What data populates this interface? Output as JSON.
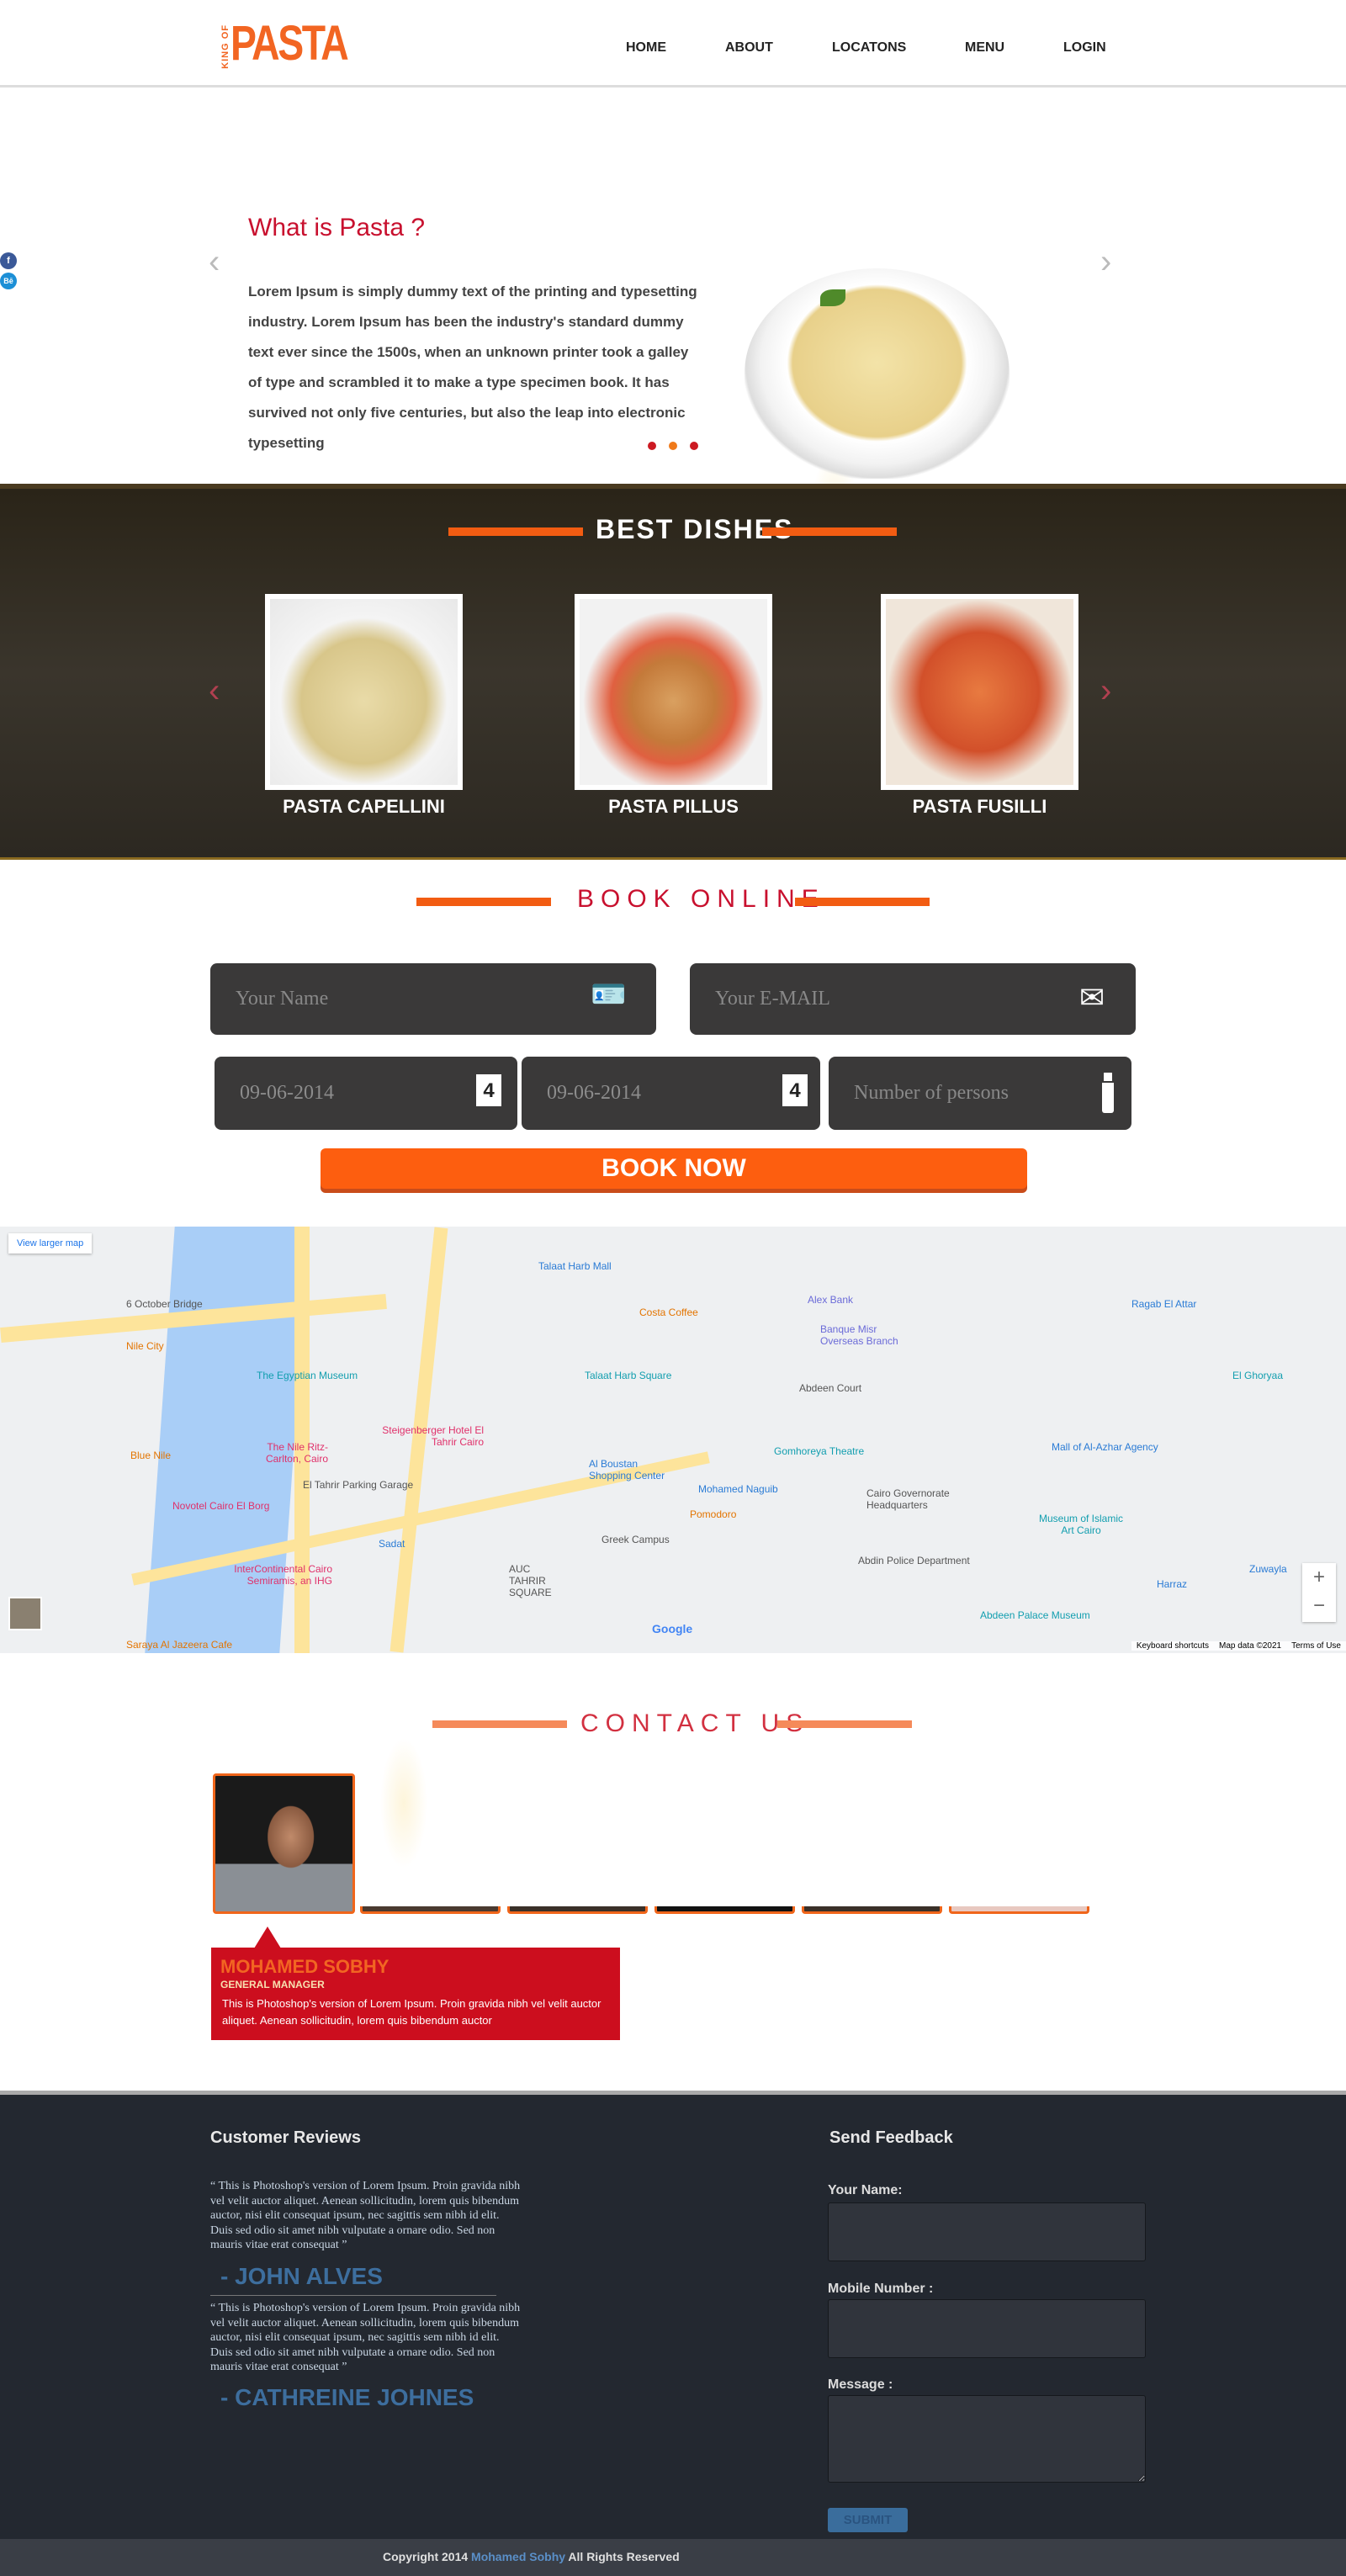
{
  "logo": {
    "small": "KING OF",
    "big": "PASTA"
  },
  "nav": [
    "HOME",
    "ABOUT",
    "LOCATONS",
    "MENU",
    "LOGIN"
  ],
  "hero": {
    "title": "What is Pasta ?",
    "text": "Lorem Ipsum is simply dummy text of the printing and typesetting industry. Lorem Ipsum has been the industry's standard dummy text ever since the 1500s, when an unknown printer took a galley of type and scrambled it to make a type specimen book. It has survived not only five centuries, but also the leap into electronic typesetting",
    "slide_count": 3
  },
  "social": {
    "facebook": "f",
    "behance": "Bē"
  },
  "dishes": {
    "title": "BEST DISHES",
    "items": [
      "PASTA CAPELLINI",
      "PASTA PILLUS",
      "PASTA FUSILLI"
    ]
  },
  "booking": {
    "title": "BOOK ONLINE",
    "name_placeholder": "Your Name",
    "email_placeholder": "Your E-MAIL",
    "date1": "09-06-2014",
    "date2": "09-06-2014",
    "persons_placeholder": "Number of persons",
    "calendar_day": "4",
    "button": "BOOK NOW"
  },
  "map": {
    "larger": "View larger map",
    "labels": [
      "Talaat Harb Mall",
      "Costa Coffee",
      "Alex Bank",
      "Banque Misr Overseas Branch",
      "The Egyptian Museum",
      "Talaat Harb Square",
      "Abdeen Court",
      "Steigenberger Hotel El Tahrir Cairo",
      "The Nile Ritz-Carlton, Cairo",
      "Al Boustan Shopping Center",
      "Gomhoreya Theatre",
      "Mall of Al-Azhar Agency",
      "Mohamed Naguib",
      "Cairo Governorate Headquarters",
      "Novotel Cairo El Borg",
      "Museum of Islamic Art Cairo",
      "Greek Campus",
      "Abdin Police Department",
      "InterContinental Cairo Semiramis, an IHG",
      "Abdeen Palace Museum",
      "Saraya Al Jazeera Cafe",
      "6 October Bridge",
      "Nile City",
      "Blue Nile",
      "El Tahrir Parking Garage",
      "Sadat",
      "Pomodoro",
      "AUC TAHRIR SQUARE",
      "Ragab El Attar",
      "El Ghoryaa",
      "Harraz",
      "Zuwayla"
    ],
    "footer": [
      "Keyboard shortcuts",
      "Map data ©2021",
      "Terms of Use"
    ],
    "google": "Google"
  },
  "contact": {
    "title": "CONTACT US",
    "person": {
      "name": "MOHAMED SOBHY",
      "role": "GENERAL MANAGER",
      "text": "This is Photoshop's version  of Lorem Ipsum. Proin gravida nibh vel velit auctor aliquet. Aenean sollicitudin, lorem quis bibendum auctor"
    }
  },
  "footer": {
    "reviews_title": "Customer Reviews",
    "reviews": [
      {
        "text": "“ This is Photoshop's version of Lorem Ipsum. Proin gravida nibh vel velit auctor aliquet. Aenean sollicitudin, lorem quis bibendum auctor, nisi elit consequat ipsum, nec sagittis sem nibh id elit. Duis sed odio sit amet nibh vulputate a ornare odio. Sed non mauris vitae erat consequat ”",
        "name": "- JOHN ALVES"
      },
      {
        "text": "“ This is Photoshop's version of Lorem Ipsum. Proin gravida nibh vel velit auctor aliquet. Aenean sollicitudin, lorem quis bibendum auctor, nisi elit consequat ipsum, nec sagittis sem nibh id elit. Duis sed odio sit amet nibh vulputate a ornare odio. Sed non mauris vitae erat consequat ”",
        "name": "- CATHREINE JOHNES"
      }
    ],
    "feedback_title": "Send Feedback",
    "name_label": "Your Name:",
    "mobile_label": "Mobile Number :",
    "message_label": "Message :",
    "submit": "SUBMIT",
    "copyright_pre": "Copyright 2014",
    "copyright_name": "Mohamed Sobhy",
    "copyright_post": "All Rights Reserved"
  },
  "colors": {
    "accent": "#f25c12",
    "red": "#cc0e1e",
    "footer": "#232830",
    "link": "#3d6e9e"
  }
}
